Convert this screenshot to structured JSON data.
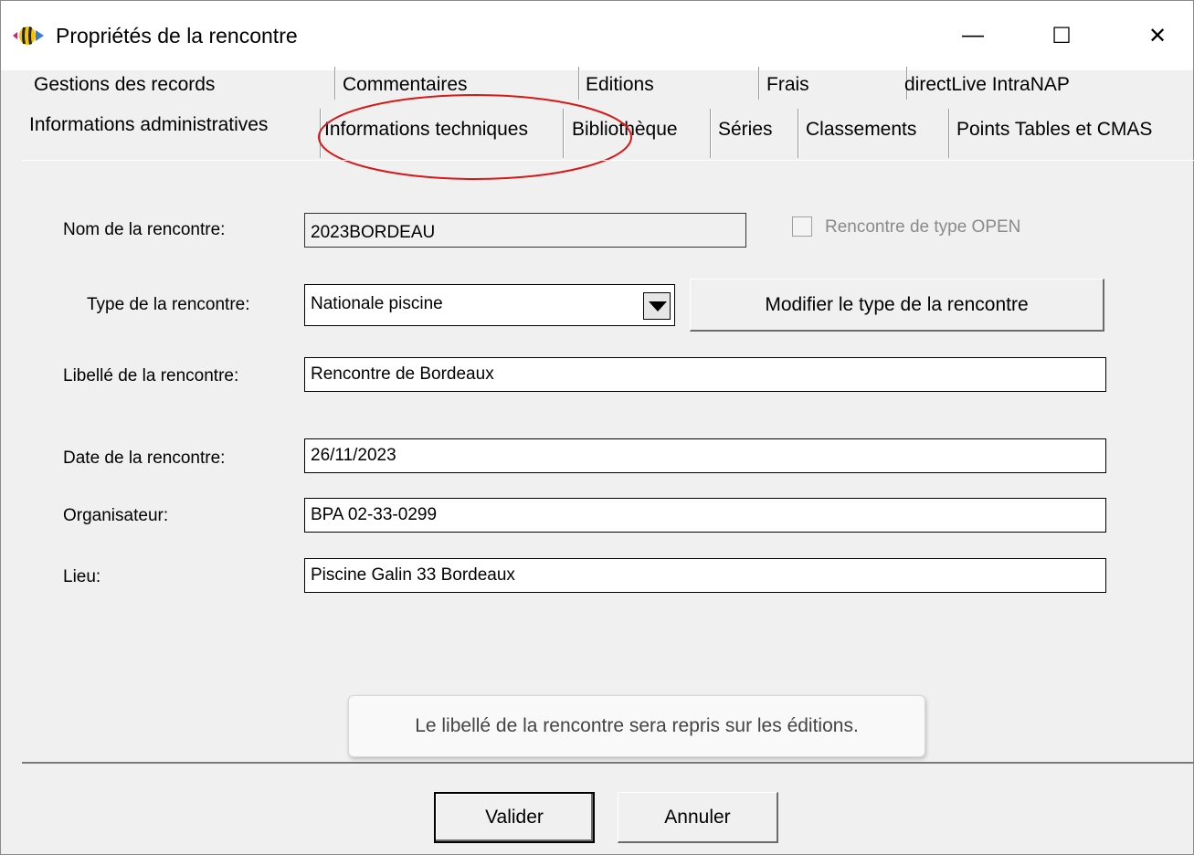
{
  "window": {
    "title": "Propriétés de la rencontre",
    "minimize_glyph": "—",
    "maximize_glyph": "☐",
    "close_glyph": "✕",
    "icon": "fish-app-icon"
  },
  "tabs": {
    "row1": [
      "Gestions des records",
      "Commentaires",
      "Editions",
      "Frais",
      "directLive IntraNAP"
    ],
    "row2": [
      "Informations administratives",
      "Informations techniques",
      "Bibliothèque",
      "Séries",
      "Classements",
      "Points Tables et CMAS"
    ],
    "active": "Informations administratives"
  },
  "form": {
    "nom_label": "Nom de la rencontre:",
    "nom_value": "2023BORDEAU",
    "open_label": "Rencontre de type OPEN",
    "open_checked": false,
    "type_label": "Type de la rencontre:",
    "type_value": "Nationale piscine",
    "modify_type_button": "Modifier le type de la rencontre",
    "libelle_label": "Libellé de la rencontre:",
    "libelle_value": "Rencontre de Bordeaux",
    "date_label": "Date de la rencontre:",
    "date_value": "26/11/2023",
    "organisateur_label": "Organisateur:",
    "organisateur_value": "BPA 02-33-0299",
    "lieu_label": "Lieu:",
    "lieu_value": "Piscine Galin 33 Bordeaux"
  },
  "tooltip": "Le libellé de la rencontre sera repris sur les éditions.",
  "buttons": {
    "ok": "Valider",
    "cancel": "Annuler"
  },
  "colors": {
    "annotation": "#d81818",
    "dialog_bg": "#f0f0f0"
  }
}
